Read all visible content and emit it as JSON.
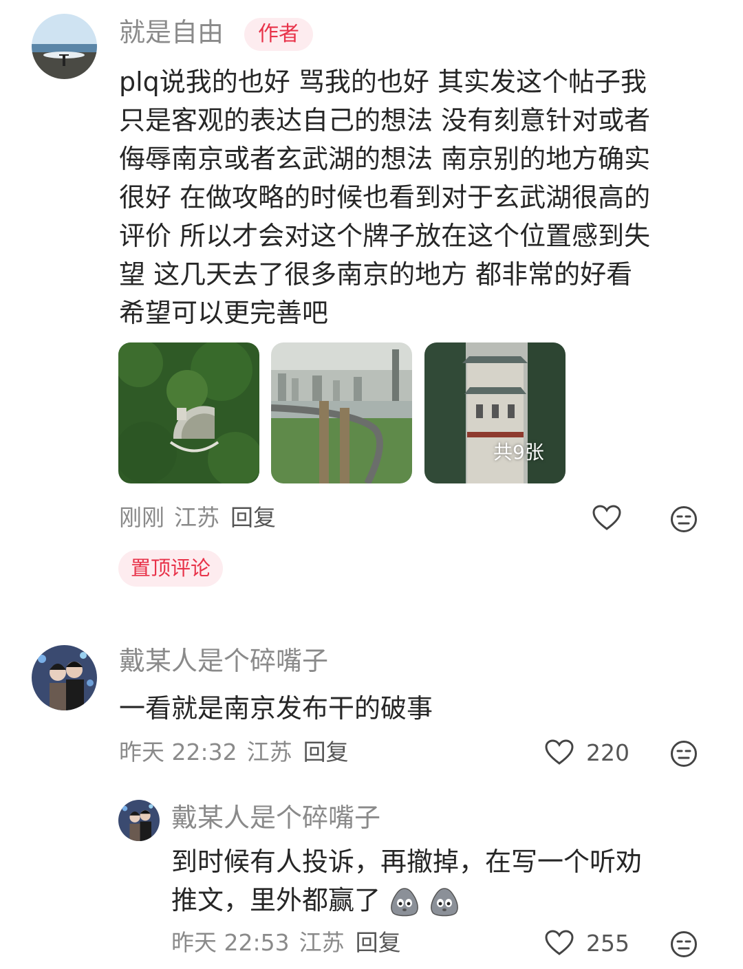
{
  "comments": [
    {
      "username": "就是自由",
      "badge": "作者",
      "text_lines": [
        "plq说我的也好 骂我的也好 其实发这个帖子我",
        "只是客观的表达自己的想法 没有刻意针对或者",
        "侮辱南京或者玄武湖的想法 南京别的地方确实",
        "很好 在做攻略的时候也看到对于玄武湖很高的",
        "评价 所以才会对这个牌子放在这个位置感到失",
        "望 这几天去了很多南京的地方 都非常的好看",
        "希望可以更完善吧"
      ],
      "image_count_label": "共9张",
      "time": "刚刚",
      "location": "江苏",
      "reply_label": "回复",
      "pinned_label": "置顶评论"
    },
    {
      "username": "戴某人是个碎嘴子",
      "text": "一看就是南京发布干的破事",
      "time": "昨天 22:32",
      "location": "江苏",
      "reply_label": "回复",
      "likes": "220"
    },
    {
      "username": "戴某人是个碎嘴子",
      "text_line1": "到时候有人投诉，再撤掉，在写一个听劝",
      "text_line2": "推文，里外都赢了",
      "time": "昨天 22:53",
      "location": "江苏",
      "reply_label": "回复",
      "likes": "255"
    }
  ],
  "colors": {
    "accent": "#e8334a",
    "badge_bg": "#fdecef",
    "meta": "#8a8a8a"
  },
  "icons": [
    "heart-icon",
    "meh-face-icon",
    "sad-blob-emoji"
  ]
}
